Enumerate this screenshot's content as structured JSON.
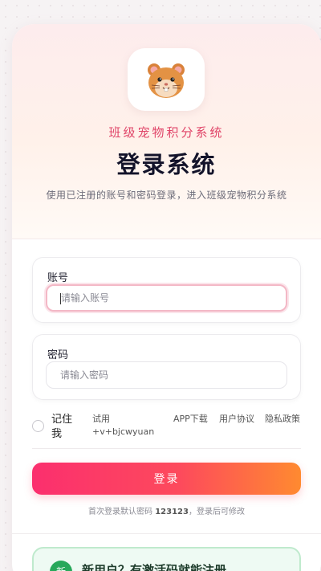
{
  "header": {
    "brand": "班级宠物积分系统",
    "title": "登录系统",
    "subtitle": "使用已注册的账号和密码登录，进入班级宠物积分系统"
  },
  "form": {
    "account_label": "账号",
    "account_placeholder": "请输入账号",
    "password_label": "密码",
    "password_placeholder": "请输入密码"
  },
  "options": {
    "remember": "记住我",
    "trial": "试用 +v+bjcwyuan",
    "app_download": "APP下载",
    "user_agreement": "用户协议",
    "privacy_policy": "隐私政策"
  },
  "login_button": "登录",
  "hint": {
    "before": "首次登录默认密码 ",
    "password": "123123",
    "after": "，登录后可修改"
  },
  "promo": {
    "badge": "新",
    "text": "新用户？有激活码就能注册"
  },
  "colors": {
    "accent": "#fb2f6e",
    "accent_end": "#ff8a30",
    "brand_text": "#e04468",
    "promo_green": "#27a85a"
  },
  "icons": {
    "logo": "hamster-icon"
  }
}
